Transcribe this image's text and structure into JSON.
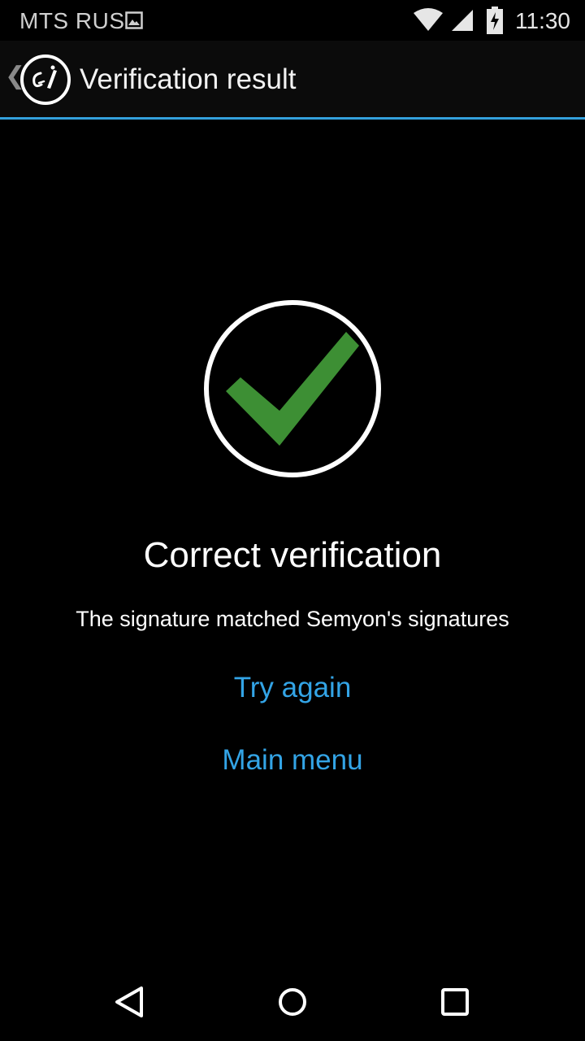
{
  "status_bar": {
    "carrier": "MTS RUS",
    "time": "11:30",
    "icons": [
      "gallery-icon",
      "wifi-icon",
      "cell-signal-icon",
      "battery-charging-icon"
    ]
  },
  "action_bar": {
    "back_icon": "chevron-left-icon",
    "app_icon": "signature-pen-icon",
    "title": "Verification result",
    "accent_color": "#33a0dc"
  },
  "result": {
    "icon": "checkmark-icon",
    "icon_color": "#3d8f34",
    "title": "Correct verification",
    "message": "The signature matched Semyon's signatures"
  },
  "actions": {
    "try_again": "Try again",
    "main_menu": "Main menu",
    "link_color": "#33a4e6"
  },
  "nav_bar": {
    "icons": [
      "back-triangle-icon",
      "home-circle-icon",
      "recents-square-icon"
    ]
  }
}
